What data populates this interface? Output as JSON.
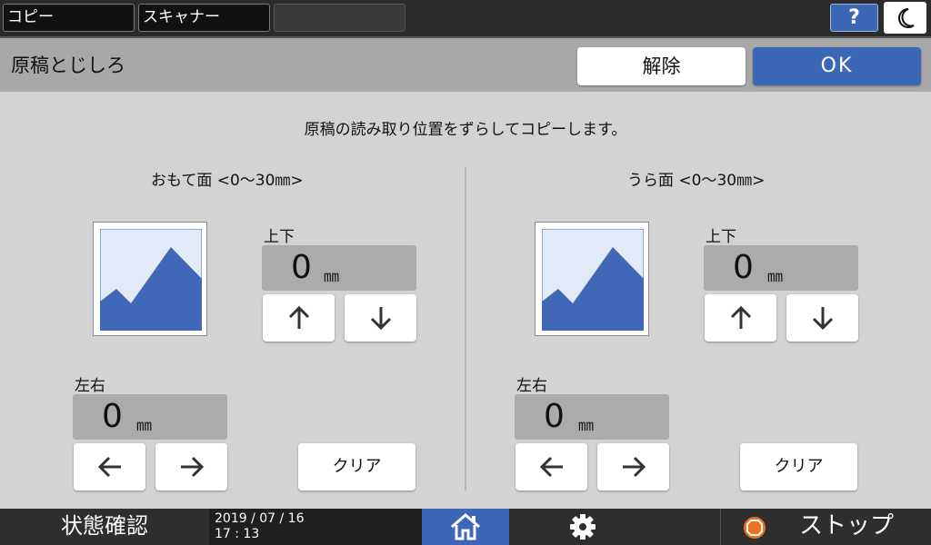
{
  "tabs": [
    {
      "label": "コピー"
    },
    {
      "label": "スキャナー"
    },
    {
      "label": ""
    }
  ],
  "topbar": {
    "help_label": "?"
  },
  "header": {
    "title": "原稿とじしろ",
    "cancel_label": "解除",
    "ok_label": "OK"
  },
  "main": {
    "description": "原稿の読み取り位置をずらしてコピーします。",
    "front": {
      "title": "おもて面 <0〜30㎜>",
      "vertical": {
        "label": "上下",
        "value": "0",
        "unit": "㎜"
      },
      "horizontal": {
        "label": "左右",
        "value": "0",
        "unit": "㎜"
      },
      "clear_label": "クリア"
    },
    "back": {
      "title": "うら面 <0〜30㎜>",
      "vertical": {
        "label": "上下",
        "value": "0",
        "unit": "㎜"
      },
      "horizontal": {
        "label": "左右",
        "value": "0",
        "unit": "㎜"
      },
      "clear_label": "クリア"
    }
  },
  "bottombar": {
    "status_label": "状態確認",
    "date": "2019 / 07 / 16",
    "time": "17 : 13",
    "stop_label": "ストップ"
  },
  "icons": {
    "arrow_up": "arrow-up-icon",
    "arrow_down": "arrow-down-icon",
    "arrow_left": "arrow-left-icon",
    "arrow_right": "arrow-right-icon",
    "home": "home-icon",
    "gear": "gear-icon",
    "stop": "stop-icon",
    "moon": "moon-icon"
  },
  "colors": {
    "accent_blue": "#3c67b5",
    "stop_orange": "#f07020",
    "thumbnail_sky": "#e2e9f7",
    "thumbnail_mountain": "#4168b6"
  }
}
